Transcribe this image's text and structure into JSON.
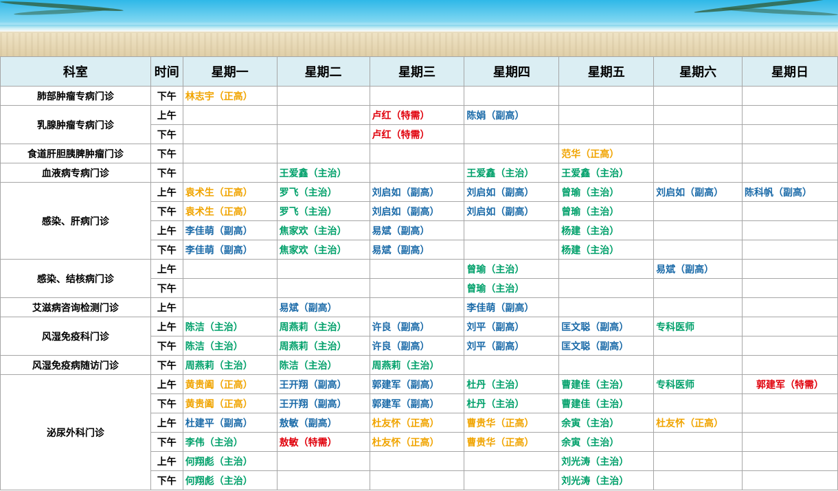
{
  "header": {
    "dept": "科室",
    "time": "时间",
    "days": [
      "星期一",
      "星期二",
      "星期三",
      "星期四",
      "星期五",
      "星期六",
      "星期日"
    ]
  },
  "colors": {
    "green": "#00a06a",
    "blue": "#1a6aa8",
    "orange": "#f0a400",
    "red": "#e0000b",
    "header_bg": "#dbeef3"
  },
  "departments": [
    {
      "name": "肺部肿瘤专病门诊",
      "rows": [
        {
          "time": "下午",
          "cells": [
            {
              "text": "林志宇（正高）",
              "color": "orange"
            },
            null,
            null,
            null,
            null,
            null,
            null
          ]
        }
      ]
    },
    {
      "name": "乳腺肿瘤专病门诊",
      "rows": [
        {
          "time": "上午",
          "cells": [
            null,
            null,
            {
              "text": "卢红（特需）",
              "color": "red"
            },
            {
              "text": "陈娟（副高）",
              "color": "blue"
            },
            null,
            null,
            null
          ]
        },
        {
          "time": "下午",
          "cells": [
            null,
            null,
            {
              "text": "卢红（特需）",
              "color": "red"
            },
            null,
            null,
            null,
            null
          ]
        }
      ]
    },
    {
      "name": "食道肝胆胰脾肿瘤门诊",
      "rows": [
        {
          "time": "下午",
          "cells": [
            null,
            null,
            null,
            null,
            {
              "text": "范华（正高）",
              "color": "orange"
            },
            null,
            null
          ]
        }
      ]
    },
    {
      "name": "血液病专病门诊",
      "rows": [
        {
          "time": "下午",
          "cells": [
            null,
            {
              "text": "王爱鑫（主治）",
              "color": "green"
            },
            null,
            {
              "text": "王爱鑫（主治）",
              "color": "green"
            },
            {
              "text": "王爱鑫（主治）",
              "color": "green"
            },
            null,
            null
          ]
        }
      ]
    },
    {
      "name": "感染、肝病门诊",
      "rows": [
        {
          "time": "上午",
          "cells": [
            {
              "text": "袁术生（正高）",
              "color": "orange"
            },
            {
              "text": "罗飞（主治）",
              "color": "green"
            },
            {
              "text": "刘启如（副高）",
              "color": "blue"
            },
            {
              "text": "刘启如（副高）",
              "color": "blue"
            },
            {
              "text": "曾瑜（主治）",
              "color": "green"
            },
            {
              "text": "刘启如（副高）",
              "color": "blue"
            },
            {
              "text": "陈科帆（副高）",
              "color": "blue"
            }
          ]
        },
        {
          "time": "下午",
          "cells": [
            {
              "text": "袁术生（正高）",
              "color": "orange"
            },
            {
              "text": "罗飞（主治）",
              "color": "green"
            },
            {
              "text": "刘启如（副高）",
              "color": "blue"
            },
            {
              "text": "刘启如（副高）",
              "color": "blue"
            },
            {
              "text": "曾瑜（主治）",
              "color": "green"
            },
            null,
            null
          ]
        },
        {
          "time": "上午",
          "cells": [
            {
              "text": "李佳萌（副高）",
              "color": "blue"
            },
            {
              "text": "焦家欢（主治）",
              "color": "green"
            },
            {
              "text": "易斌（副高）",
              "color": "blue"
            },
            null,
            {
              "text": "杨建（主治）",
              "color": "green"
            },
            null,
            null
          ]
        },
        {
          "time": "下午",
          "cells": [
            {
              "text": "李佳萌（副高）",
              "color": "blue"
            },
            {
              "text": "焦家欢（主治）",
              "color": "green"
            },
            {
              "text": "易斌（副高）",
              "color": "blue"
            },
            null,
            {
              "text": "杨建（主治）",
              "color": "green"
            },
            null,
            null
          ]
        }
      ]
    },
    {
      "name": "感染、结核病门诊",
      "rows": [
        {
          "time": "上午",
          "cells": [
            null,
            null,
            null,
            {
              "text": "曾瑜（主治）",
              "color": "green"
            },
            null,
            {
              "text": "易斌（副高）",
              "color": "blue"
            },
            null
          ]
        },
        {
          "time": "下午",
          "cells": [
            null,
            null,
            null,
            {
              "text": "曾瑜（主治）",
              "color": "green"
            },
            null,
            null,
            null
          ]
        }
      ]
    },
    {
      "name": "艾滋病咨询检测门诊",
      "rows": [
        {
          "time": "上午",
          "cells": [
            null,
            {
              "text": "易斌（副高）",
              "color": "blue"
            },
            null,
            {
              "text": "李佳萌（副高）",
              "color": "blue"
            },
            null,
            null,
            null
          ]
        }
      ]
    },
    {
      "name": "风湿免疫科门诊",
      "rows": [
        {
          "time": "上午",
          "cells": [
            {
              "text": "陈洁（主治）",
              "color": "green"
            },
            {
              "text": "周燕莉（主治）",
              "color": "green"
            },
            {
              "text": "许良（副高）",
              "color": "blue"
            },
            {
              "text": "刘平（副高）",
              "color": "blue"
            },
            {
              "text": "匡文聪（副高）",
              "color": "blue"
            },
            {
              "text": "专科医师",
              "color": "green"
            },
            null
          ]
        },
        {
          "time": "下午",
          "cells": [
            {
              "text": "陈洁（主治）",
              "color": "green"
            },
            {
              "text": "周燕莉（主治）",
              "color": "green"
            },
            {
              "text": "许良（副高）",
              "color": "blue"
            },
            {
              "text": "刘平（副高）",
              "color": "blue"
            },
            {
              "text": "匡文聪（副高）",
              "color": "blue"
            },
            null,
            null
          ]
        }
      ]
    },
    {
      "name": "风湿免疫病随访门诊",
      "rows": [
        {
          "time": "下午",
          "cells": [
            {
              "text": "周燕莉（主治）",
              "color": "green"
            },
            {
              "text": "陈洁（主治）",
              "color": "green"
            },
            {
              "text": "周燕莉（主治）",
              "color": "green"
            },
            null,
            null,
            null,
            null
          ]
        }
      ]
    },
    {
      "name": "泌尿外科门诊",
      "rows": [
        {
          "time": "上午",
          "cells": [
            {
              "text": "黄贵阖（正高）",
              "color": "orange"
            },
            {
              "text": "王开翔（副高）",
              "color": "blue"
            },
            {
              "text": "郭建军（副高）",
              "color": "blue"
            },
            {
              "text": "杜丹（主治）",
              "color": "green"
            },
            {
              "text": "曹建佳（主治）",
              "color": "green"
            },
            {
              "text": "专科医师",
              "color": "green"
            },
            {
              "text": "郭建军（特需）",
              "color": "red"
            }
          ]
        },
        {
          "time": "下午",
          "cells": [
            {
              "text": "黄贵阖（正高）",
              "color": "orange"
            },
            {
              "text": "王开翔（副高）",
              "color": "blue"
            },
            {
              "text": "郭建军（副高）",
              "color": "blue"
            },
            {
              "text": "杜丹（主治）",
              "color": "green"
            },
            {
              "text": "曹建佳（主治）",
              "color": "green"
            },
            null,
            null
          ]
        },
        {
          "time": "上午",
          "cells": [
            {
              "text": "杜建平（副高）",
              "color": "blue"
            },
            {
              "text": "敖敏（副高）",
              "color": "blue"
            },
            {
              "text": "杜友怀（正高）",
              "color": "orange"
            },
            {
              "text": "曹贵华（正高）",
              "color": "orange"
            },
            {
              "text": "余寅（主治）",
              "color": "green"
            },
            {
              "text": "杜友怀（正高）",
              "color": "orange"
            },
            null
          ]
        },
        {
          "time": "下午",
          "cells": [
            {
              "text": "李伟（主治）",
              "color": "green"
            },
            {
              "text": "敖敏（特需）",
              "color": "red"
            },
            {
              "text": "杜友怀（正高）",
              "color": "orange"
            },
            {
              "text": "曹贵华（正高）",
              "color": "orange"
            },
            {
              "text": "余寅（主治）",
              "color": "green"
            },
            null,
            null
          ]
        },
        {
          "time": "上午",
          "cells": [
            {
              "text": "何翔彪（主治）",
              "color": "green"
            },
            null,
            null,
            null,
            {
              "text": "刘光涛（主治）",
              "color": "green"
            },
            null,
            null
          ]
        },
        {
          "time": "下午",
          "cells": [
            {
              "text": "何翔彪（主治）",
              "color": "green"
            },
            null,
            null,
            null,
            {
              "text": "刘光涛（主治）",
              "color": "green"
            },
            null,
            null
          ]
        }
      ]
    }
  ]
}
